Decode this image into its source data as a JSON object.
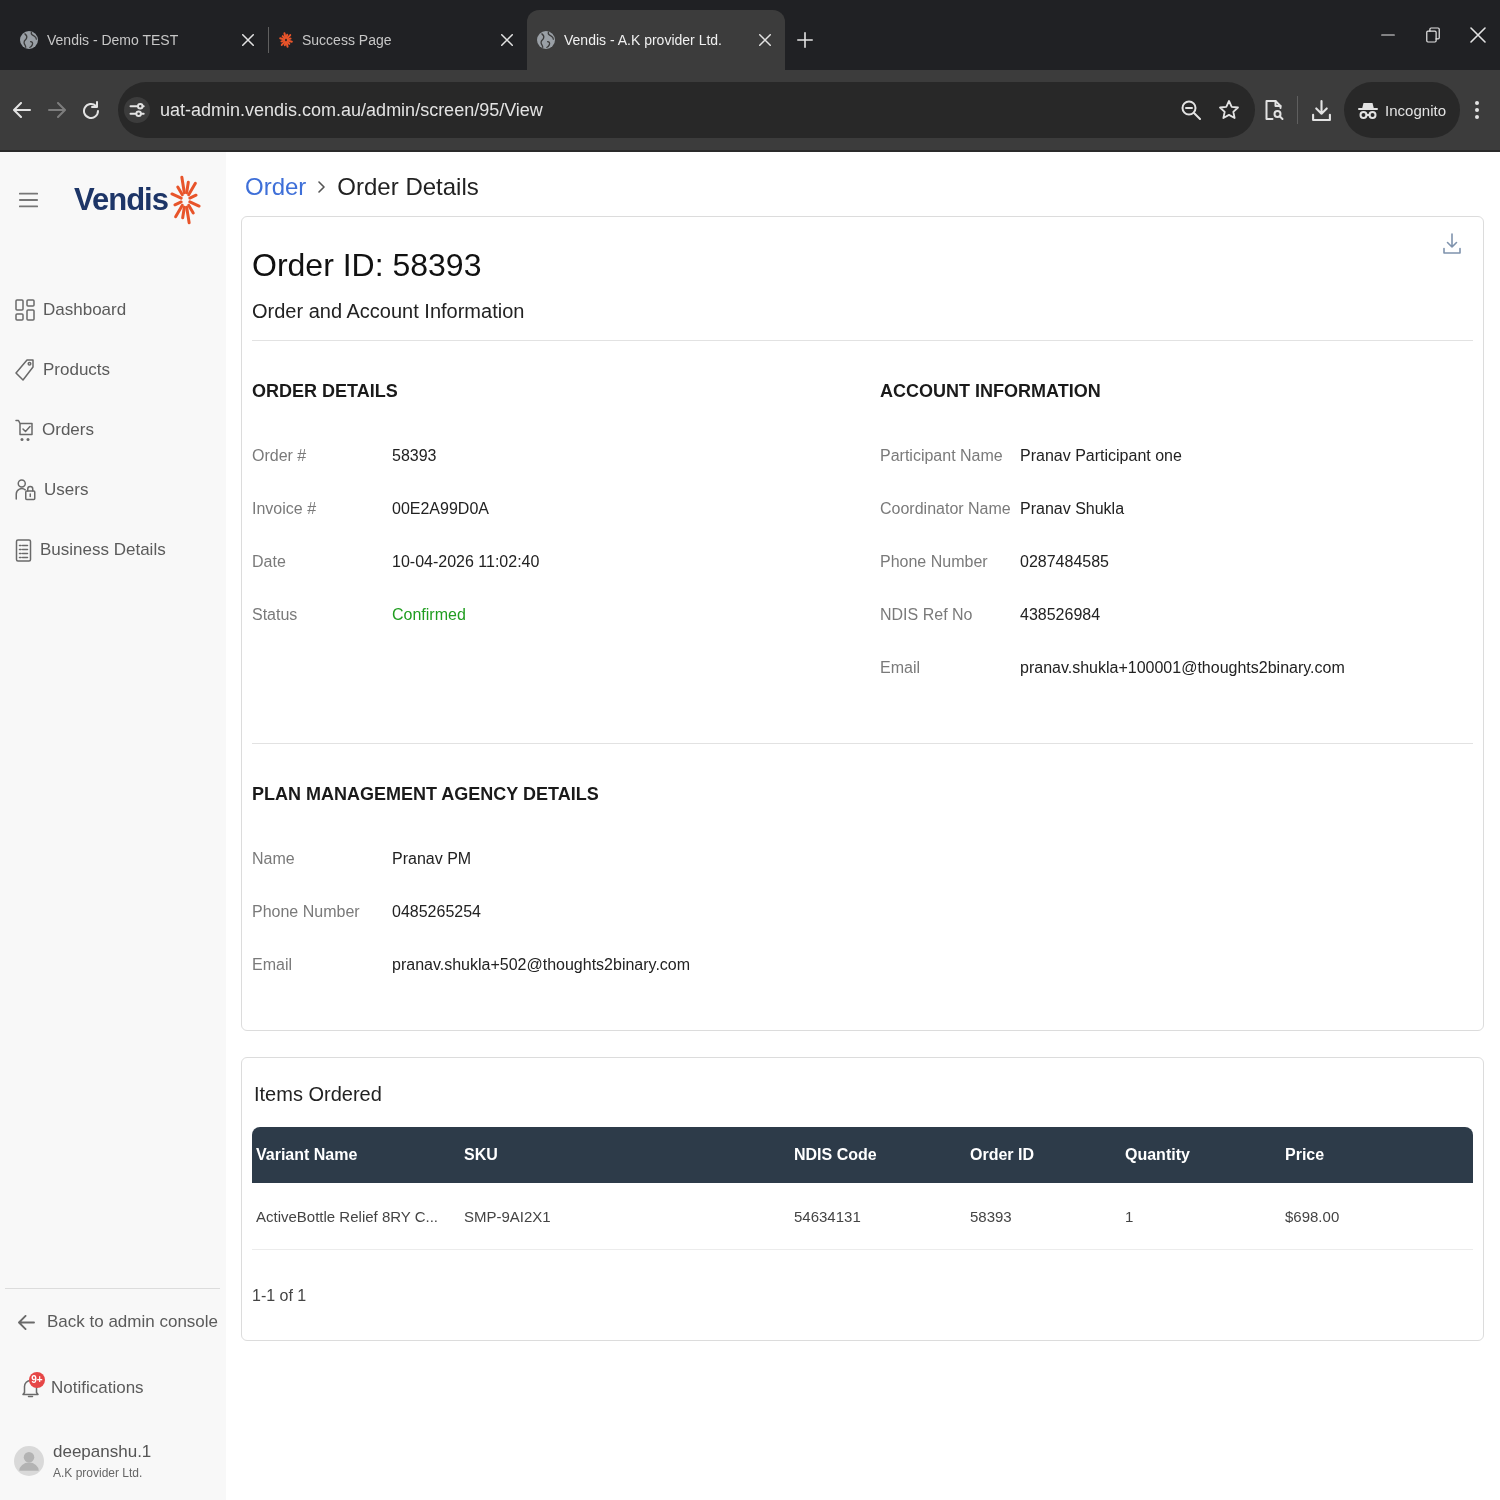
{
  "browser": {
    "tabs": [
      {
        "title": "Vendis - Demo TEST",
        "kind": "generic",
        "selected": false
      },
      {
        "title": "Success Page",
        "kind": "branded",
        "selected": false
      },
      {
        "title": "Vendis - A.K provider Ltd.",
        "kind": "generic",
        "selected": true
      }
    ],
    "nav_buttons": [
      {
        "kind": "back",
        "disabled": false
      },
      {
        "kind": "forward",
        "disabled": true
      },
      {
        "kind": "reload",
        "disabled": false
      }
    ],
    "url": "uat-admin.vendis.com.au/admin/screen/95/View",
    "profile": "Incognito"
  },
  "sidebar": {
    "logo": "Vendis",
    "items": [
      {
        "label": "Dashboard",
        "selected": false
      },
      {
        "label": "Products",
        "selected": false
      },
      {
        "label": "Orders",
        "selected": false
      },
      {
        "label": "Users",
        "selected": false
      },
      {
        "label": "Business Details",
        "selected": false
      }
    ],
    "back_link": "Back to admin console",
    "notifications": {
      "label": "Notifications",
      "badge": "9+"
    },
    "user": {
      "name": "deepanshu.1",
      "organization": "A.K provider Ltd."
    }
  },
  "breadcrumb": [
    "Order",
    "Order Details"
  ],
  "order_card": {
    "title": "Order ID: 58393",
    "subtitle": "Order and Account Information",
    "section_rows": [
      [
        {
          "heading": "ORDER DETAILS",
          "fields": [
            {
              "label": "Order #",
              "value": "58393"
            },
            {
              "label": "Invoice #",
              "value": "00E2A99D0A"
            },
            {
              "label": "Date",
              "value": "10-04-2026 11:02:40"
            },
            {
              "label": "Status",
              "value": "Confirmed",
              "color": "#1f9d1f"
            }
          ]
        },
        {
          "heading": "ACCOUNT INFORMATION",
          "fields": [
            {
              "label": "Participant Name",
              "value": "Pranav Participant one"
            },
            {
              "label": "Coordinator Name",
              "value": "Pranav Shukla"
            },
            {
              "label": "Phone Number",
              "value": "0287484585"
            },
            {
              "label": "NDIS Ref No",
              "value": "438526984"
            },
            {
              "label": "Email",
              "value": "pranav.shukla+100001@thoughts2binary.com"
            }
          ]
        }
      ],
      [
        {
          "heading": "PLAN MANAGEMENT AGENCY DETAILS",
          "fields": [
            {
              "label": "Name",
              "value": "Pranav PM"
            },
            {
              "label": "Phone Number",
              "value": "0485265254"
            },
            {
              "label": "Email",
              "value": "pranav.shukla+502@thoughts2binary.com"
            }
          ]
        }
      ]
    ]
  },
  "items_card": {
    "title": "Items Ordered",
    "table": {
      "columns": [
        "Variant Name",
        "SKU",
        "NDIS Code",
        "Order ID",
        "Quantity",
        "Price"
      ],
      "rows": [
        [
          "ActiveBottle Relief 8RY C...",
          "SMP-9AI2X1",
          "54634131",
          "58393",
          "1",
          "$698.00"
        ]
      ]
    },
    "pagination": "1-1 of 1"
  }
}
